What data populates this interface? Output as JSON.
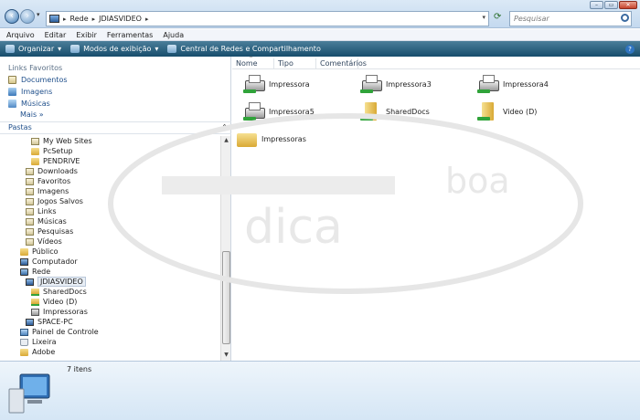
{
  "address": {
    "crumbs": [
      "Rede",
      "JDIASVIDEO"
    ],
    "search_placeholder": "Pesquisar"
  },
  "menu": [
    "Arquivo",
    "Editar",
    "Exibir",
    "Ferramentas",
    "Ajuda"
  ],
  "toolbar": {
    "organize": "Organizar",
    "views": "Modos de exibição",
    "network_center": "Central de Redes e Compartilhamento"
  },
  "favorites": {
    "title": "Links Favoritos",
    "items": [
      "Documentos",
      "Imagens",
      "Músicas"
    ],
    "more": "Mais"
  },
  "folders_header": "Pastas",
  "tree": [
    {
      "label": "My Web Sites",
      "icon": "sys"
    },
    {
      "label": "PcSetup",
      "icon": "folder"
    },
    {
      "label": "PENDRIVE",
      "icon": "folder"
    },
    {
      "label": "Downloads",
      "icon": "sys"
    },
    {
      "label": "Favoritos",
      "icon": "sys"
    },
    {
      "label": "Imagens",
      "icon": "sys"
    },
    {
      "label": "Jogos Salvos",
      "icon": "sys"
    },
    {
      "label": "Links",
      "icon": "sys"
    },
    {
      "label": "Músicas",
      "icon": "sys"
    },
    {
      "label": "Pesquisas",
      "icon": "sys"
    },
    {
      "label": "Vídeos",
      "icon": "sys"
    },
    {
      "label": "Público",
      "icon": "folder"
    },
    {
      "label": "Computador",
      "icon": "pc"
    },
    {
      "label": "Rede",
      "icon": "net"
    },
    {
      "label": "JDIASVIDEO",
      "icon": "pc"
    },
    {
      "label": "SharedDocs",
      "icon": "share"
    },
    {
      "label": "Video (D)",
      "icon": "share"
    },
    {
      "label": "Impressoras",
      "icon": "printer"
    },
    {
      "label": "SPACE-PC",
      "icon": "pc"
    },
    {
      "label": "Painel de Controle",
      "icon": "panel"
    },
    {
      "label": "Lixeira",
      "icon": "bin"
    },
    {
      "label": "Adobe",
      "icon": "folder"
    }
  ],
  "columns": [
    "Nome",
    "Tipo",
    "Comentários"
  ],
  "items": [
    {
      "label": "Impressora",
      "icon": "printer"
    },
    {
      "label": "Impressora3",
      "icon": "printer"
    },
    {
      "label": "Impressora4",
      "icon": "printer"
    },
    {
      "label": "Impressora5",
      "icon": "printer"
    },
    {
      "label": "SharedDocs",
      "icon": "folder"
    },
    {
      "label": "Video (D)",
      "icon": "folder"
    },
    {
      "label": "Impressoras",
      "icon": "multi"
    }
  ],
  "status": {
    "count": "7 itens"
  },
  "watermark": {
    "line1": "boa",
    "line2": "dica"
  }
}
